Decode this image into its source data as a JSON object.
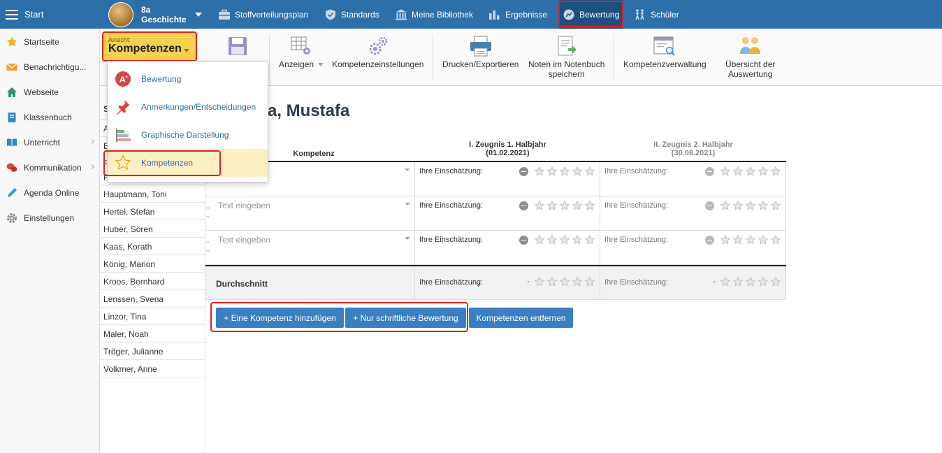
{
  "topbar": {
    "start": "Start",
    "class_line1": "8a",
    "class_line2": "Geschichte",
    "nav": [
      {
        "label": "Stoffverteilungsplan",
        "icon": "briefcase-icon"
      },
      {
        "label": "Standards",
        "icon": "shield-check-icon"
      },
      {
        "label": "Meine Bibliothek",
        "icon": "library-icon"
      },
      {
        "label": "Ergebnisse",
        "icon": "bar-chart-icon"
      },
      {
        "label": "Bewertung",
        "icon": "gauge-icon"
      },
      {
        "label": "Schüler",
        "icon": "students-walking-icon"
      }
    ]
  },
  "sidebar": {
    "items": [
      {
        "label": "Startseite",
        "icon": "star-icon"
      },
      {
        "label": "Benachrichtigu...",
        "icon": "envelope-icon"
      },
      {
        "label": "Webseite",
        "icon": "home-icon"
      },
      {
        "label": "Klassenbuch",
        "icon": "book-icon"
      },
      {
        "label": "Unterricht",
        "icon": "open-book-icon"
      },
      {
        "label": "Kommunikation",
        "icon": "chat-icon"
      },
      {
        "label": "Agenda Online",
        "icon": "pen-icon"
      },
      {
        "label": "Einstellungen",
        "icon": "gear-icon"
      }
    ]
  },
  "view": {
    "small": "Ansicht:",
    "big": "Kompetenzen"
  },
  "toolbar": {
    "anzeigen": "Anzeigen",
    "kompetenzeinstellungen": "Kompetenzeinstellungen",
    "drucken": "Drucken/Exportieren",
    "noten_1": "Noten im Notenbuch",
    "noten_2": "speichern",
    "kompetenzverwaltung": "Kompetenzverwaltung",
    "uebersicht_1": "Übersicht der",
    "uebersicht_2": "Auswertung"
  },
  "dropdown": {
    "items": [
      {
        "label": "Bewertung",
        "icon": "grade-a-plus-icon"
      },
      {
        "label": "Anmerkungen/Entscheidungen",
        "icon": "pushpin-icon"
      },
      {
        "label": "Graphische Darstellung",
        "icon": "bar-chart-icon"
      },
      {
        "label": "Kompetenzen",
        "icon": "star-outline-icon"
      }
    ]
  },
  "students": {
    "header": "S",
    "partial": [
      "A",
      "B",
      "F"
    ],
    "list": [
      "Freytag, Lina",
      "Hauptmann, Toni",
      "Hertel, Stefan",
      "Huber, Sören",
      "Kaas, Korath",
      "König, Marion",
      "Kroos, Bernhard",
      "Lenssen, Svena",
      "Linzor, Tina",
      "Maler, Noah",
      "Tröger, Julianne",
      "Volkmer, Anne"
    ]
  },
  "main": {
    "student_name": "a, Mustafa",
    "col_kompetenz": "Kompetenz",
    "col1_title": "I. Zeugnis 1. Halbjahr",
    "col1_date": "(01.02.2021)",
    "col2_title": "II. Zeugnis 2. Halbjahr",
    "col2_date": "(30.08.2021)",
    "rows": [
      {
        "text": "",
        "label1": "Ihre Einschätzung:",
        "label2": "Ihre Einschätzung:",
        "rating1": 0,
        "rating2": 0
      },
      {
        "text": "Text eingeben",
        "label1": "Ihre Einschätzung:",
        "label2": "Ihre Einschätzung:",
        "rating1": 0,
        "rating2": 0
      },
      {
        "text": "Text eingeben",
        "label1": "Ihre Einschätzung:",
        "label2": "Ihre Einschätzung:",
        "rating1": 0,
        "rating2": 0
      }
    ],
    "avg_label": "Durchschnitt",
    "avg_label1": "Ihre Einschätzung:",
    "avg_label2": "Ihre Einschätzung:",
    "avg_value1": "-",
    "avg_value2": "-"
  },
  "buttons": {
    "add": "+ Eine Kompetenz hinzufügen",
    "written": "+ Nur schriftliche Bewertung",
    "remove": "Kompetenzen entfernen"
  },
  "colors": {
    "topbar": "#2d6fa8",
    "accent_yellow": "#f4d24e",
    "button": "#3a7fc1",
    "highlight": "#e02020"
  }
}
